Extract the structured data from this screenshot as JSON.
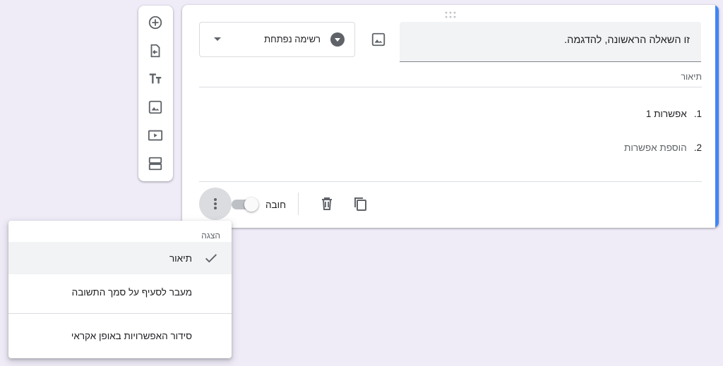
{
  "toolbar": {
    "buttons": [
      {
        "icon": "add-circle-icon"
      },
      {
        "icon": "import-question-icon"
      },
      {
        "icon": "title-text-icon",
        "glyph": "Tт"
      },
      {
        "icon": "image-icon"
      },
      {
        "icon": "video-icon"
      },
      {
        "icon": "section-icon"
      }
    ]
  },
  "question": {
    "title": "זו השאלה הראשונה, להדגמה.",
    "type_label": "רשימה נפתחת",
    "description_placeholder": "תיאור",
    "options": [
      {
        "num": "1.",
        "text": "אפשרות 1"
      },
      {
        "num": "2.",
        "text": "הוספת אפשרות"
      }
    ],
    "required_label": "חובה"
  },
  "menu": {
    "header": "הצגה",
    "items": [
      {
        "label": "תיאור",
        "checked": true
      },
      {
        "label": "מעבר לסעיף על סמך התשובה",
        "checked": false
      },
      {
        "label": "סידור האפשרויות באופן אקראי",
        "checked": false
      }
    ]
  },
  "colors": {
    "background": "#efebf7",
    "accent": "#4285f4",
    "icon": "#5f6368"
  }
}
